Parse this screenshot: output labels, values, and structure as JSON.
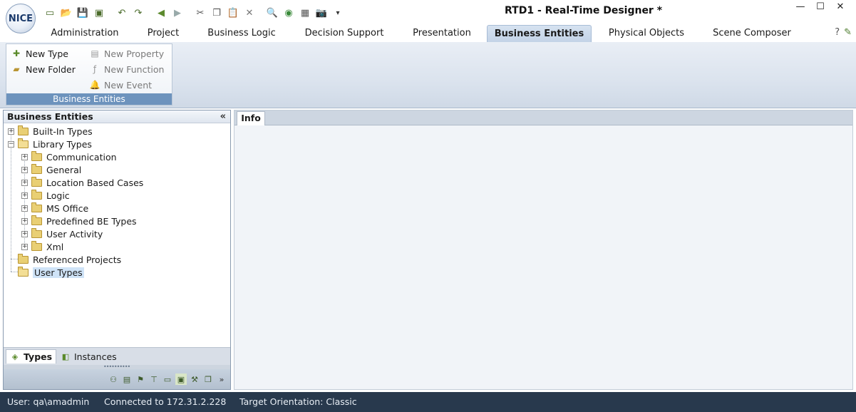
{
  "window": {
    "title": "RTD1 - Real-Time Designer *",
    "logo_text": "NICE",
    "controls": [
      "minimize",
      "maximize",
      "close"
    ]
  },
  "quick_access_toolbar": {
    "icons": [
      "new-icon",
      "open-icon",
      "save-icon",
      "save-all-icon",
      "undo-icon",
      "redo-icon",
      "back-icon",
      "forward-icon",
      "cut-icon",
      "copy-icon",
      "paste-icon",
      "delete-icon",
      "find-icon",
      "run-icon",
      "build-icon",
      "camera-icon",
      "customize-icon"
    ]
  },
  "ribbon": {
    "tabs": [
      {
        "label": "Administration"
      },
      {
        "label": "Project"
      },
      {
        "label": "Business Logic"
      },
      {
        "label": "Decision Support"
      },
      {
        "label": "Presentation"
      },
      {
        "label": "Business Entities",
        "active": true
      },
      {
        "label": "Physical Objects"
      },
      {
        "label": "Scene Composer"
      }
    ],
    "group": {
      "label": "Business Entities",
      "buttons": [
        {
          "label": "New Type",
          "icon": "new-type-icon",
          "enabled": true
        },
        {
          "label": "New Folder",
          "icon": "new-folder-icon",
          "enabled": true
        },
        {
          "label": "New Property",
          "icon": "new-property-icon",
          "enabled": false
        },
        {
          "label": "New Function",
          "icon": "new-function-icon",
          "enabled": false
        },
        {
          "label": "New Event",
          "icon": "new-event-icon",
          "enabled": false
        }
      ]
    }
  },
  "left_panel": {
    "title": "Business Entities",
    "tree": [
      {
        "label": "Built-In Types",
        "level": 0,
        "expander": "plus"
      },
      {
        "label": "Library Types",
        "level": 0,
        "expander": "minus"
      },
      {
        "label": "Communication",
        "level": 1,
        "expander": "plus"
      },
      {
        "label": "General",
        "level": 1,
        "expander": "plus"
      },
      {
        "label": "Location Based Cases",
        "level": 1,
        "expander": "plus"
      },
      {
        "label": "Logic",
        "level": 1,
        "expander": "plus"
      },
      {
        "label": "MS Office",
        "level": 1,
        "expander": "plus"
      },
      {
        "label": "Predefined BE Types",
        "level": 1,
        "expander": "plus"
      },
      {
        "label": "User Activity",
        "level": 1,
        "expander": "plus"
      },
      {
        "label": "Xml",
        "level": 1,
        "expander": "plus"
      },
      {
        "label": "Referenced Projects",
        "level": 0,
        "expander": "none"
      },
      {
        "label": "User Types",
        "level": 0,
        "expander": "none",
        "selected": true
      }
    ],
    "tabs": [
      {
        "label": "Types",
        "active": true
      },
      {
        "label": "Instances",
        "active": false
      }
    ]
  },
  "right_panel": {
    "tabs": [
      {
        "label": "Info",
        "active": true
      }
    ]
  },
  "status_bar": {
    "user": "User: qa\\amadmin",
    "connection": "Connected to 172.31.2.228",
    "orientation": "Target Orientation: Classic"
  }
}
